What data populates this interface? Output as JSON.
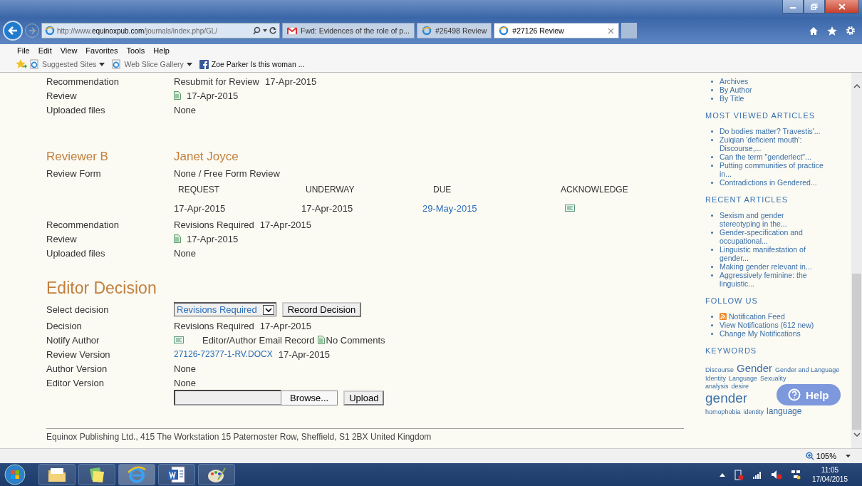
{
  "browser": {
    "address": "http://www.**equinoxpub.com**/journals/index.php/GL/",
    "tabs": [
      {
        "title": "Fwd: Evidences of the role of p...",
        "kind": "mail",
        "selected": false
      },
      {
        "title": "#26498 Review",
        "kind": "web",
        "selected": false
      },
      {
        "title": "#27126 Review",
        "kind": "web",
        "selected": true
      }
    ],
    "menu": [
      "File",
      "Edit",
      "View",
      "Favorites",
      "Tools",
      "Help"
    ],
    "favorites": [
      {
        "label": "Suggested Sites",
        "kind": "web",
        "dropdown": true
      },
      {
        "label": "Web Slice Gallery",
        "kind": "web",
        "dropdown": true
      },
      {
        "label": "Zoe Parker Is this woman ...",
        "kind": "social",
        "dropdown": false
      }
    ]
  },
  "reviewer_a": {
    "rows": [
      {
        "label": "Recommendation",
        "kind": "text",
        "value": "Resubmit for Review",
        "date": "17-Apr-2015"
      },
      {
        "label": "Review",
        "kind": "doc",
        "value": "17-Apr-2015"
      },
      {
        "label": "Uploaded files",
        "kind": "text",
        "value": "None"
      }
    ]
  },
  "reviewer_b": {
    "heading": "Reviewer B",
    "name": "Janet Joyce",
    "form_label": "Review Form",
    "form_value": "None / Free Form Review",
    "columns": [
      "REQUEST",
      "UNDERWAY",
      "DUE",
      "ACKNOWLEDGE"
    ],
    "dates": [
      {
        "value": "17-Apr-2015",
        "link": false
      },
      {
        "value": "17-Apr-2015",
        "link": false
      },
      {
        "value": "29-May-2015",
        "link": true
      }
    ],
    "rows": [
      {
        "label": "Recommendation",
        "kind": "text",
        "value": "Revisions Required",
        "date": "17-Apr-2015"
      },
      {
        "label": "Review",
        "kind": "doc",
        "value": "17-Apr-2015"
      },
      {
        "label": "Uploaded files",
        "kind": "text",
        "value": "None"
      }
    ]
  },
  "editor_decision": {
    "heading": "Editor Decision",
    "select_label": "Select decision",
    "select_value": "Revisions Required",
    "record_button": "Record Decision",
    "rows": [
      {
        "label": "Decision",
        "kind": "text",
        "value": "Revisions Required",
        "date": "17-Apr-2015"
      },
      {
        "label": "Notify Author",
        "kind": "notify",
        "value": "Editor/Author Email Record",
        "note": "No Comments"
      },
      {
        "label": "Review Version",
        "kind": "link",
        "value": "27126-72377-1-RV.DOCX",
        "date": "17-Apr-2015"
      },
      {
        "label": "Author Version",
        "kind": "text",
        "value": "None"
      },
      {
        "label": "Editor Version",
        "kind": "text",
        "value": "None"
      }
    ],
    "browse_button": "Browse...",
    "upload_button": "Upload"
  },
  "footer": "Equinox Publishing Ltd., 415 The Workstation 15 Paternoster Row, Sheffield, S1 2BX United Kingdom",
  "sidebar": {
    "browse": [
      "Archives",
      "By Author",
      "By Title"
    ],
    "sections": [
      {
        "title": "MOST VIEWED ARTICLES",
        "items": [
          {
            "text": "Do bodies matter? Travestis'...",
            "rss": false
          },
          {
            "text": "Zuiqian 'deficient mouth': Discourse,...",
            "rss": false
          },
          {
            "text": "Can the term \"genderlect\"...",
            "rss": false
          },
          {
            "text": "Putting communities of practice in...",
            "rss": false
          },
          {
            "text": "Contradictions in Gendered...",
            "rss": false
          }
        ]
      },
      {
        "title": "RECENT ARTICLES",
        "items": [
          {
            "text": "Sexism and gender stereotyping in the...",
            "rss": false
          },
          {
            "text": "Gender-specification and occupational...",
            "rss": false
          },
          {
            "text": "Linguistic manifestation of gender...",
            "rss": false
          },
          {
            "text": "Making gender relevant in...",
            "rss": false
          },
          {
            "text": "Aggressively feminine: the linguistic...",
            "rss": false
          }
        ]
      },
      {
        "title": "FOLLOW US",
        "items": [
          {
            "text": "Notification Feed",
            "rss": true
          },
          {
            "text": "View Notifications (612 new)",
            "rss": false
          },
          {
            "text": "Change My Notifications",
            "rss": false
          }
        ]
      }
    ],
    "keywords_title": "KEYWORDS",
    "keyword_rows": [
      [
        {
          "word": "Discourse",
          "kind": "small"
        },
        {
          "word": "Gender",
          "kind": "large"
        },
        {
          "word": "Gender and Language",
          "kind": "small"
        }
      ],
      [
        {
          "word": "Identity",
          "kind": "small"
        },
        {
          "word": "Language",
          "kind": "small"
        },
        {
          "word": "Sexuality",
          "kind": "small"
        }
      ],
      [
        {
          "word": "analysis",
          "kind": "small"
        },
        {
          "word": "desire",
          "kind": "small"
        }
      ],
      [
        {
          "word": "gender",
          "kind": "xlarge"
        }
      ],
      [
        {
          "word": "homophobia",
          "kind": "small"
        },
        {
          "word": "identity",
          "kind": "small"
        },
        {
          "word": "language",
          "kind": "medium"
        }
      ]
    ]
  },
  "help_button": "Help",
  "status": {
    "zoom": "105%"
  },
  "taskbar": {
    "time": "11:05",
    "date": "17/04/2015"
  }
}
